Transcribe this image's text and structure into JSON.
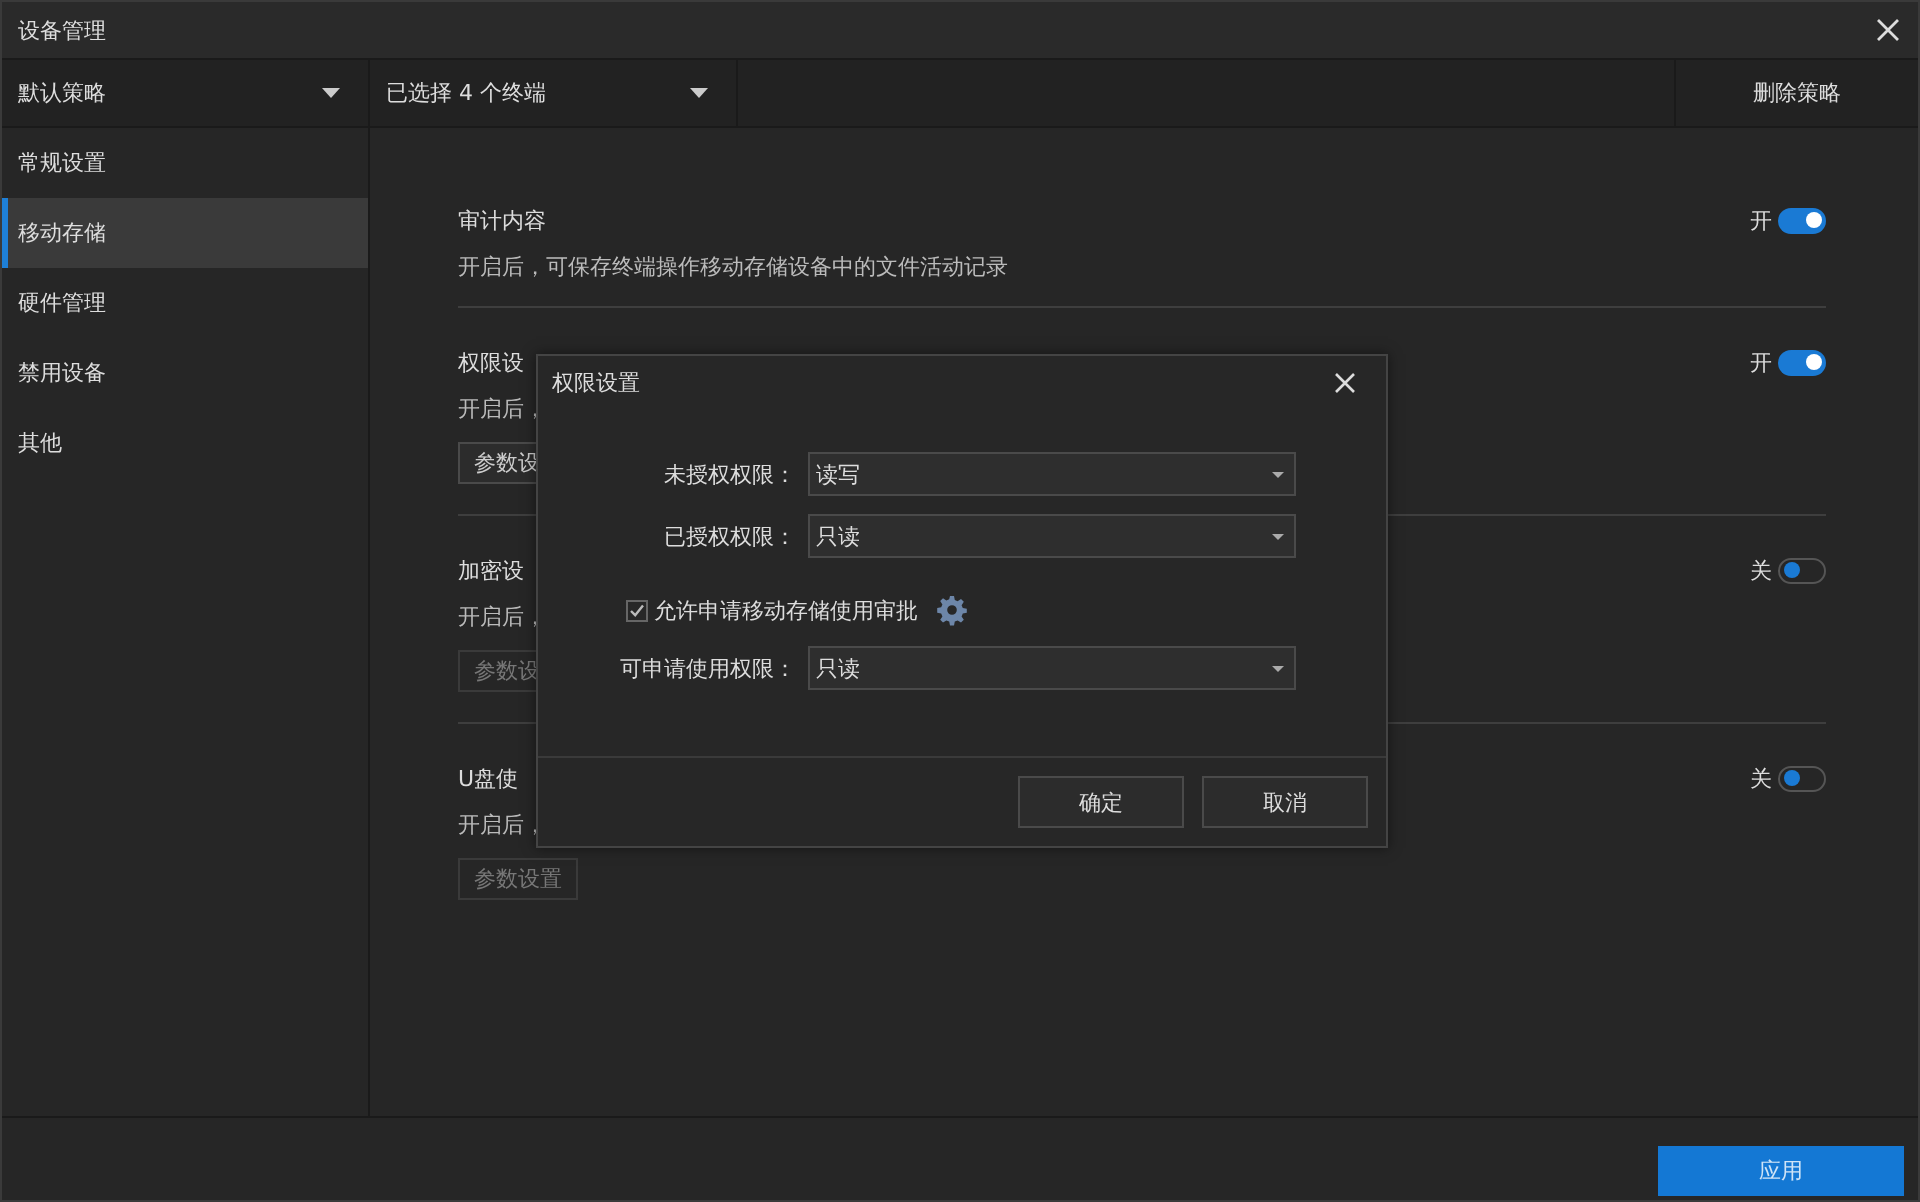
{
  "window": {
    "title": "设备管理"
  },
  "toolbar": {
    "policy": "默认策略",
    "terminals": "已选择 4 个终端",
    "delete_button": "删除策略"
  },
  "sidebar": {
    "items": [
      {
        "label": "常规设置",
        "selected": false
      },
      {
        "label": "移动存储",
        "selected": true
      },
      {
        "label": "硬件管理",
        "selected": false
      },
      {
        "label": "禁用设备",
        "selected": false
      },
      {
        "label": "其他",
        "selected": false
      }
    ]
  },
  "sections": [
    {
      "title": "审计内容",
      "description": "开启后，可保存终端操作移动存储设备中的文件活动记录",
      "toggle_label": "开",
      "on": true
    },
    {
      "title": "权限设",
      "description": "开启后，",
      "button": {
        "label": "参数设",
        "disabled": false
      },
      "toggle_label": "开",
      "on": true
    },
    {
      "title": "加密设",
      "description": "开启后，",
      "button": {
        "label": "参数设",
        "disabled": true
      },
      "toggle_label": "关",
      "on": false
    },
    {
      "title": "U盘使",
      "description": "开启后，",
      "button": {
        "label": "参数设置",
        "disabled": true
      },
      "toggle_label": "关",
      "on": false
    }
  ],
  "dialog": {
    "title": "权限设置",
    "fields": [
      {
        "label": "未授权权限：",
        "value": "读写"
      },
      {
        "label": "已授权权限：",
        "value": "只读"
      }
    ],
    "checkbox": {
      "label": "允许申请移动存储使用审批",
      "checked": true
    },
    "extra_field": {
      "label": "可申请使用权限：",
      "value": "只读"
    },
    "buttons": [
      "确定",
      "取消"
    ]
  },
  "footer": {
    "apply_button": "应用"
  }
}
